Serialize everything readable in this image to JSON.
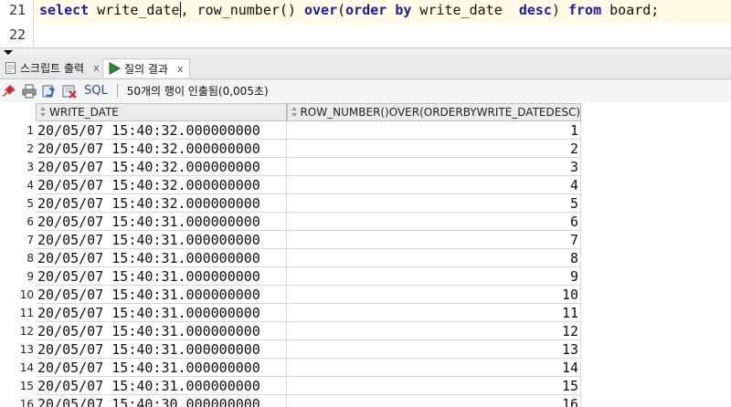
{
  "editor": {
    "lines": [
      {
        "number": "21",
        "keyword1": "select",
        "text1": " write_date",
        "text2": ", row_number() ",
        "keyword2": "over",
        "text3": "(",
        "keyword3": "order by",
        "text4": " write_date  ",
        "keyword4": "desc",
        "text5": ") ",
        "keyword5": "from",
        "text6": " board;"
      },
      {
        "number": "22"
      }
    ]
  },
  "tabs": [
    {
      "label": "스크립트 출력",
      "close": "x",
      "icon": "script-output-icon"
    },
    {
      "label": "질의 결과",
      "close": "x",
      "icon": "run-arrow-icon"
    }
  ],
  "toolbar": {
    "sql_label": "SQL",
    "status": "50개의 행이 인출됨(0,005초)",
    "icons": [
      "pin-icon",
      "print-icon",
      "refresh-icon",
      "export-icon"
    ]
  },
  "colors": {
    "keyword": "#1a1aa6",
    "run_icon": "#2e8b2e",
    "current_line": "#fffbe6"
  },
  "grid": {
    "columns": [
      "WRITE_DATE",
      "ROW_NUMBER()OVER(ORDERBYWRITE_DATEDESC)"
    ],
    "rows": [
      {
        "n": "1",
        "date": "20/05/07 15:40:32.000000000",
        "rn": "1"
      },
      {
        "n": "2",
        "date": "20/05/07 15:40:32.000000000",
        "rn": "2"
      },
      {
        "n": "3",
        "date": "20/05/07 15:40:32.000000000",
        "rn": "3"
      },
      {
        "n": "4",
        "date": "20/05/07 15:40:32.000000000",
        "rn": "4"
      },
      {
        "n": "5",
        "date": "20/05/07 15:40:32.000000000",
        "rn": "5"
      },
      {
        "n": "6",
        "date": "20/05/07 15:40:31.000000000",
        "rn": "6"
      },
      {
        "n": "7",
        "date": "20/05/07 15:40:31.000000000",
        "rn": "7"
      },
      {
        "n": "8",
        "date": "20/05/07 15:40:31.000000000",
        "rn": "8"
      },
      {
        "n": "9",
        "date": "20/05/07 15:40:31.000000000",
        "rn": "9"
      },
      {
        "n": "10",
        "date": "20/05/07 15:40:31.000000000",
        "rn": "10"
      },
      {
        "n": "11",
        "date": "20/05/07 15:40:31.000000000",
        "rn": "11"
      },
      {
        "n": "12",
        "date": "20/05/07 15:40:31.000000000",
        "rn": "12"
      },
      {
        "n": "13",
        "date": "20/05/07 15:40:31.000000000",
        "rn": "13"
      },
      {
        "n": "14",
        "date": "20/05/07 15:40:31.000000000",
        "rn": "14"
      },
      {
        "n": "15",
        "date": "20/05/07 15:40:31.000000000",
        "rn": "15"
      },
      {
        "n": "16",
        "date": "20/05/07 15:40:30.000000000",
        "rn": "16"
      }
    ]
  }
}
